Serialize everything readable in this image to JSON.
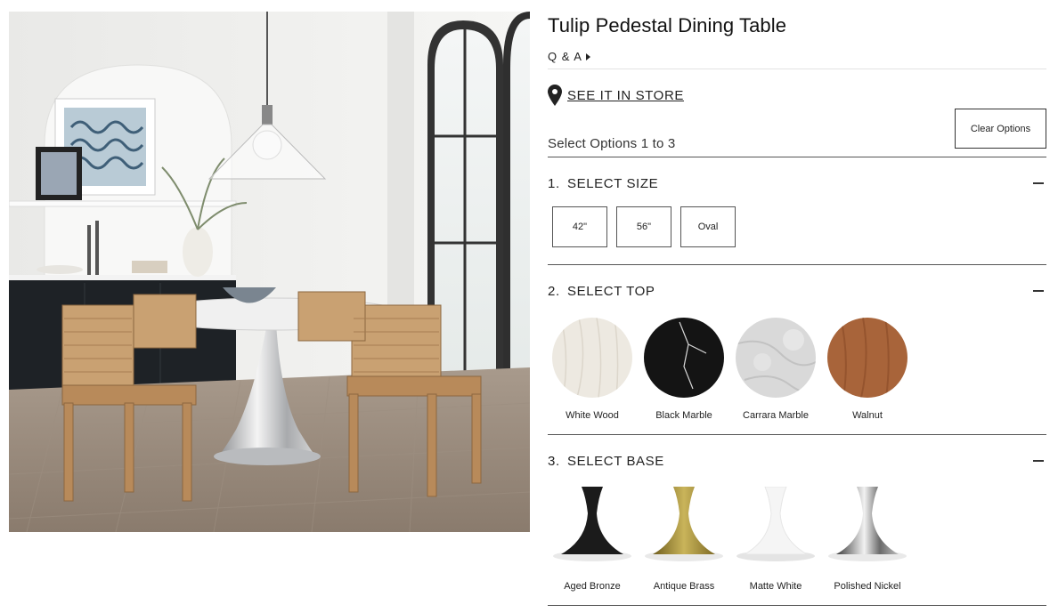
{
  "product": {
    "title": "Tulip Pedestal Dining Table",
    "image_alt": "tulip-pedestal-dining-table-room-scene"
  },
  "qa_link": "Q & A",
  "store_link": "SEE IT IN STORE",
  "clear_options_label": "Clear Options",
  "select_options_text": "Select Options 1 to 3",
  "sections": {
    "size": {
      "number": "1.",
      "title": "SELECT SIZE",
      "options": [
        "42\"",
        "56\"",
        "Oval"
      ]
    },
    "top": {
      "number": "2.",
      "title": "SELECT TOP",
      "options": [
        "White Wood",
        "Black Marble",
        "Carrara Marble",
        "Walnut"
      ]
    },
    "base": {
      "number": "3.",
      "title": "SELECT BASE",
      "options": [
        "Aged Bronze",
        "Antique Brass",
        "Matte White",
        "Polished Nickel"
      ]
    }
  },
  "icons": {
    "store": "map-pin-icon",
    "qa": "caret-right-icon",
    "collapse": "minus-icon"
  },
  "colors": {
    "white_wood": "#ede9e1",
    "black_marble": "#141414",
    "carrara_marble": "#d9d9d9",
    "walnut": "#a8643a",
    "aged_bronze": "#1b1b1b",
    "antique_brass": "#9a8433",
    "matte_white": "#f2f2f2",
    "polished_nickel": "#8c8c8c"
  }
}
